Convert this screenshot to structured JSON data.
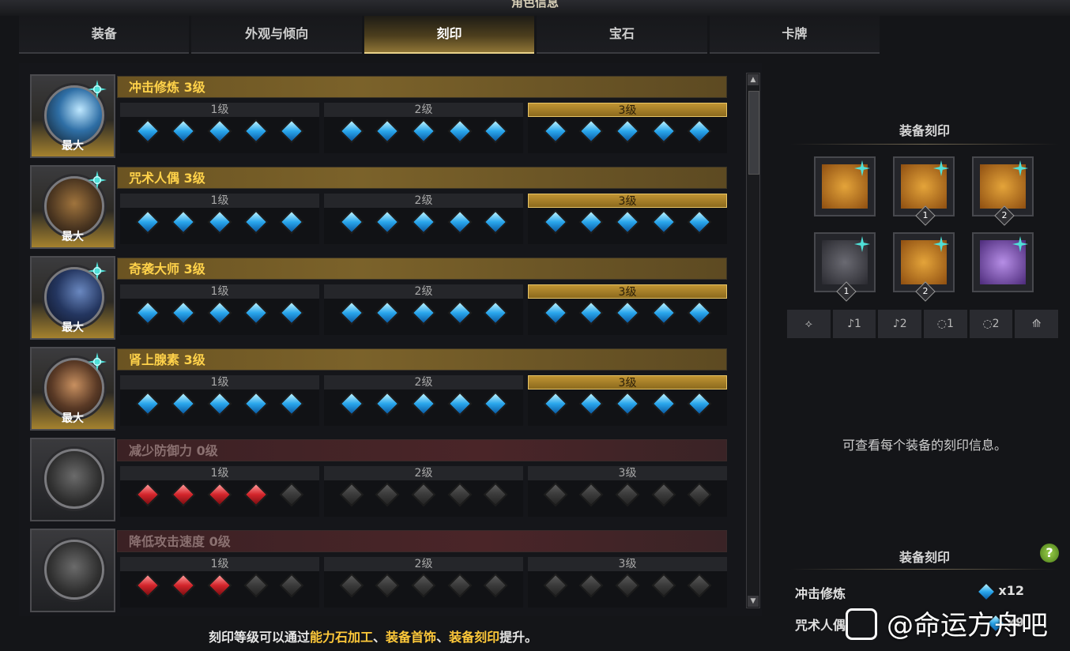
{
  "window": {
    "title": "角色信息"
  },
  "tabs": [
    "装备",
    "外观与倾向",
    "刻印",
    "宝石",
    "卡牌"
  ],
  "active_tab": "刻印",
  "level_labels": [
    "1级",
    "2级",
    "3级"
  ],
  "max_label": "最大",
  "engravings": [
    {
      "name": "冲击修炼 3级",
      "active": true,
      "gems": [
        "b",
        "b",
        "b",
        "b",
        "b",
        "b",
        "b",
        "b",
        "b",
        "b",
        "b",
        "b",
        "b",
        "b",
        "b"
      ],
      "portrait": "shockwave-icon"
    },
    {
      "name": "咒术人偶 3级",
      "active": true,
      "gems": [
        "b",
        "b",
        "b",
        "b",
        "b",
        "b",
        "b",
        "b",
        "b",
        "b",
        "b",
        "b",
        "b",
        "b",
        "b"
      ],
      "portrait": "cursed-doll-icon"
    },
    {
      "name": "奇袭大师 3级",
      "active": true,
      "gems": [
        "b",
        "b",
        "b",
        "b",
        "b",
        "b",
        "b",
        "b",
        "b",
        "b",
        "b",
        "b",
        "b",
        "b",
        "b"
      ],
      "portrait": "master-ambush-icon"
    },
    {
      "name": "肾上腺素 3级",
      "active": true,
      "gems": [
        "b",
        "b",
        "b",
        "b",
        "b",
        "b",
        "b",
        "b",
        "b",
        "b",
        "b",
        "b",
        "b",
        "b",
        "b"
      ],
      "portrait": "adrenaline-icon"
    },
    {
      "name": "减少防御力 0级",
      "active": false,
      "gems": [
        "r",
        "r",
        "r",
        "r",
        "g",
        "g",
        "g",
        "g",
        "g",
        "g",
        "g",
        "g",
        "g",
        "g",
        "g"
      ],
      "portrait": "defense-reduction-icon"
    },
    {
      "name": "降低攻击速度 0级",
      "active": false,
      "gems": [
        "r",
        "r",
        "r",
        "g",
        "g",
        "g",
        "g",
        "g",
        "g",
        "g",
        "g",
        "g",
        "g",
        "g",
        "g"
      ],
      "portrait": "attack-speed-reduction-icon"
    }
  ],
  "footer": {
    "prefix": "刻印等级可以通过",
    "h1": "能力石加工",
    "sep1": "、",
    "h2": "装备首饰",
    "sep2": "、",
    "h3": "装备刻印",
    "suffix": "提升。"
  },
  "right": {
    "equip_title": "装备刻印",
    "slots": [
      {
        "name": "necklace-icon",
        "badge": ""
      },
      {
        "name": "earring-icon",
        "badge": "1"
      },
      {
        "name": "earring-icon",
        "badge": "2"
      },
      {
        "name": "ring-icon",
        "badge": "1"
      },
      {
        "name": "ring-icon",
        "badge": "2"
      },
      {
        "name": "ability-stone-icon",
        "badge": ""
      }
    ],
    "filters": [
      {
        "icon": "necklace-filter-icon",
        "label": ""
      },
      {
        "icon": "earring-filter-icon",
        "label": "1"
      },
      {
        "icon": "earring-filter-icon",
        "label": "2"
      },
      {
        "icon": "ring-filter-icon",
        "label": "1"
      },
      {
        "icon": "ring-filter-icon",
        "label": "2"
      },
      {
        "icon": "ability-stone-filter-icon",
        "label": ""
      }
    ],
    "message": "可查看每个装备的刻印信息。",
    "summary_title": "装备刻印",
    "help": "?",
    "list": [
      {
        "name": "冲击修炼",
        "count": "x12"
      },
      {
        "name": "咒术人偶",
        "count": "x9"
      }
    ]
  },
  "watermark": "@命运方舟吧",
  "colors": {
    "gold": "#ffd24a",
    "blue_gem": "#29a6ec",
    "red_gem": "#d3252b"
  }
}
